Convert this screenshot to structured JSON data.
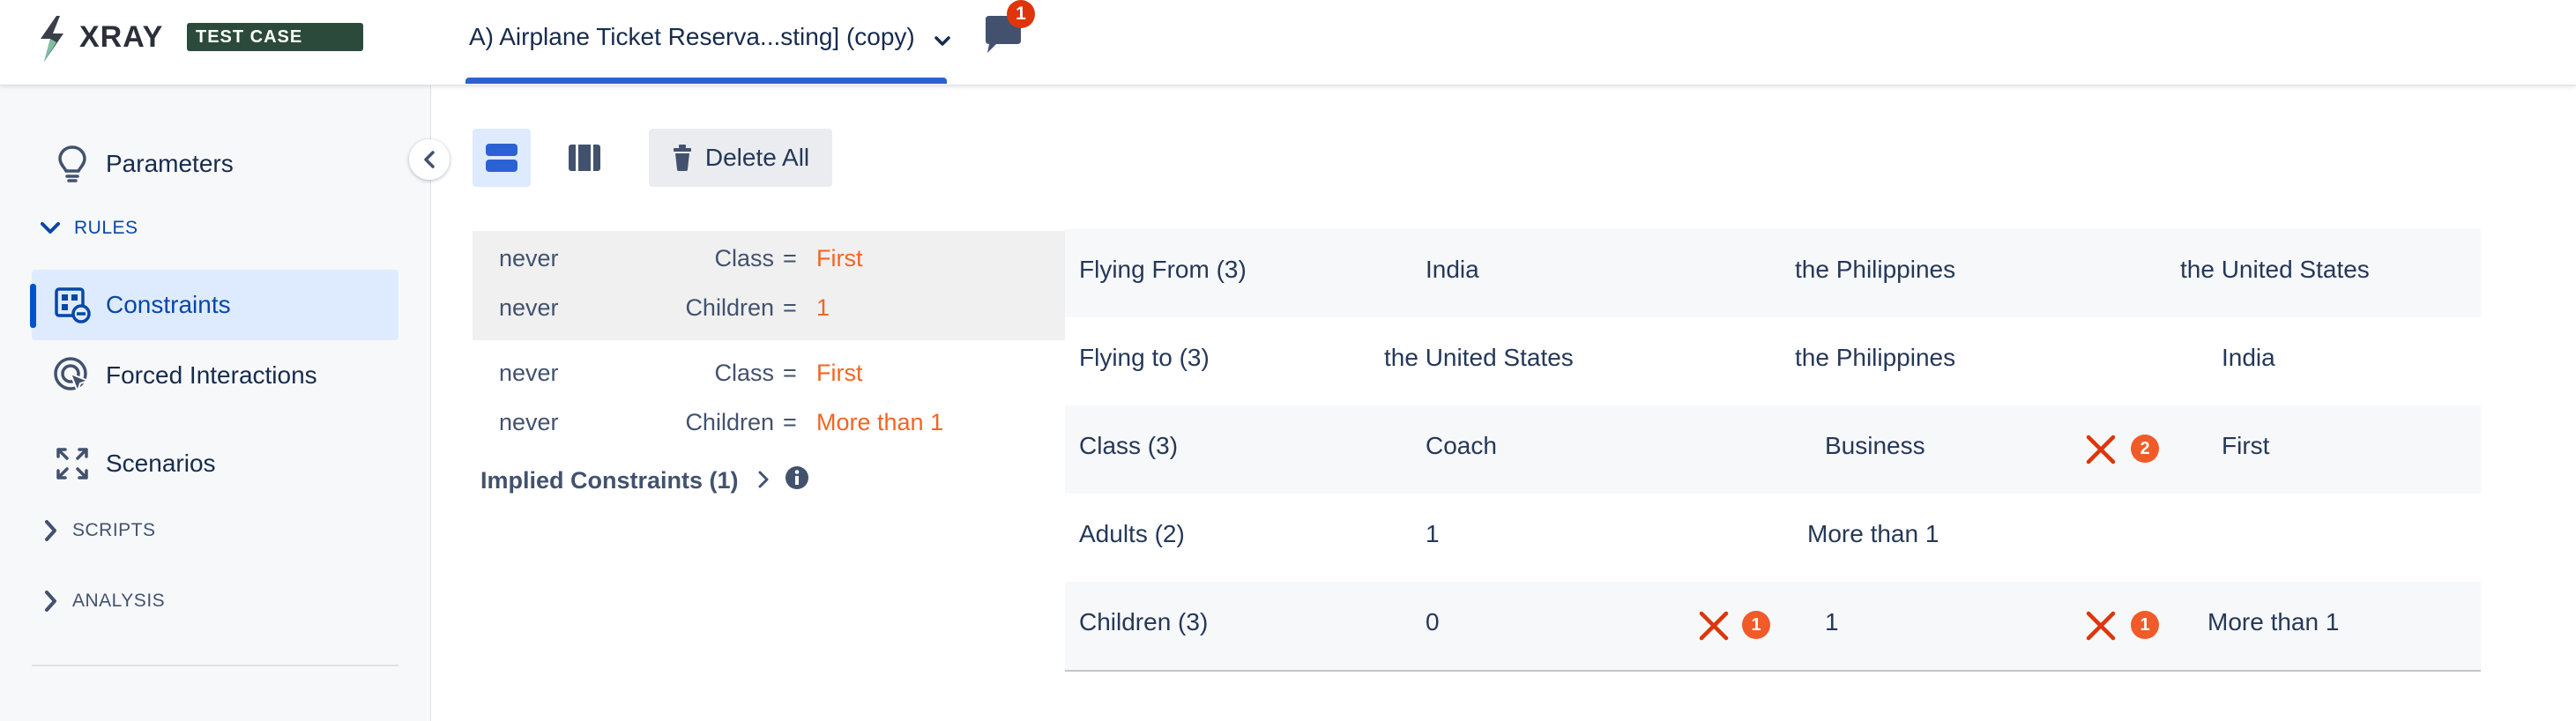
{
  "app": {
    "logo_text": "XRAY",
    "logo_badge": "TEST CASE DESIGNER",
    "project_title": "A) Airplane Ticket Reserva...sting] (copy)",
    "notification_count": "1"
  },
  "sidebar": {
    "parameters_label": "Parameters",
    "rules_section": "RULES",
    "constraints_label": "Constraints",
    "forced_label": "Forced Interactions",
    "scenarios_label": "Scenarios",
    "scripts_section": "SCRIPTS",
    "analysis_section": "ANALYSIS"
  },
  "toolbar": {
    "delete_all_label": "Delete All"
  },
  "constraints": [
    {
      "rows": [
        {
          "negation": "never",
          "parameter": "Class",
          "operator": "=",
          "value": "First"
        },
        {
          "negation": "never",
          "parameter": "Children",
          "operator": "=",
          "value": "1"
        }
      ]
    },
    {
      "rows": [
        {
          "negation": "never",
          "parameter": "Class",
          "operator": "=",
          "value": "First"
        },
        {
          "negation": "never",
          "parameter": "Children",
          "operator": "=",
          "value": "More than 1"
        }
      ]
    }
  ],
  "implied_constraints_label": "Implied Constraints (1)",
  "parameters": [
    {
      "name": "Flying From (3)",
      "values": [
        "India",
        "the Philippines",
        "the United States"
      ]
    },
    {
      "name": "Flying to (3)",
      "values": [
        "the United States",
        "the Philippines",
        "India"
      ]
    },
    {
      "name": "Class (3)",
      "values": [
        "Coach",
        "Business",
        "First"
      ],
      "marker_count": "2"
    },
    {
      "name": "Adults (2)",
      "values": [
        "1",
        "More than 1"
      ]
    },
    {
      "name": "Children (3)",
      "values": [
        "0",
        "1",
        "More than 1"
      ],
      "marker_count_1": "1",
      "marker_count_2": "1"
    }
  ],
  "colors": {
    "accent": "#2b62d3",
    "constraint_value": "#f26522",
    "conflict": "#de350b"
  }
}
